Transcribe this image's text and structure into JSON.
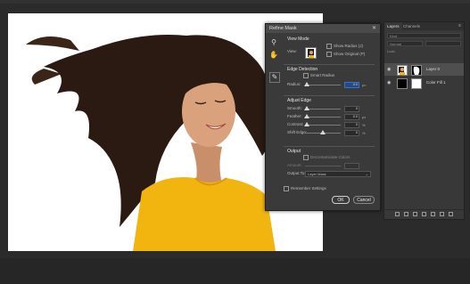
{
  "dialog": {
    "title": "Refine Mask",
    "close_glyph": "✕",
    "view_mode": {
      "title": "View Mode",
      "view_label": "View:",
      "show_radius": "Show Radius (J)",
      "show_original": "Show Original (P)"
    },
    "edge_detection": {
      "title": "Edge Detection",
      "smart_radius": "Smart Radius",
      "radius_label": "Radius:",
      "radius_value": "0.0",
      "radius_unit": "px"
    },
    "adjust_edge": {
      "title": "Adjust Edge",
      "smooth_label": "Smooth:",
      "smooth_value": "0",
      "feather_label": "Feather:",
      "feather_value": "0.0",
      "feather_unit": "px",
      "contrast_label": "Contrast:",
      "contrast_value": "0",
      "contrast_unit": "%",
      "shift_label": "Shift Edge:",
      "shift_value": "0",
      "shift_unit": "%"
    },
    "output": {
      "title": "Output",
      "decontaminate": "Decontaminate Colors",
      "amount_label": "Amount:",
      "output_to_label": "Output To:",
      "output_to_value": "Layer Mask"
    },
    "remember": "Remember Settings",
    "ok": "OK",
    "cancel": "Cancel"
  },
  "layers_panel": {
    "tab_layers": "Layers",
    "tab_channels": "Channels",
    "kind_placeholder": "Kind",
    "blend_mode": "Normal",
    "lock_label": "Lock:",
    "layers": [
      {
        "name": "Layer 0",
        "selected": true
      },
      {
        "name": "Color Fill 1",
        "selected": false
      }
    ]
  },
  "colors": {
    "shirt": "#f2b50f",
    "hair": "#2a1a12",
    "skin": "#d9a27c",
    "highlight_field": "#234a86"
  }
}
